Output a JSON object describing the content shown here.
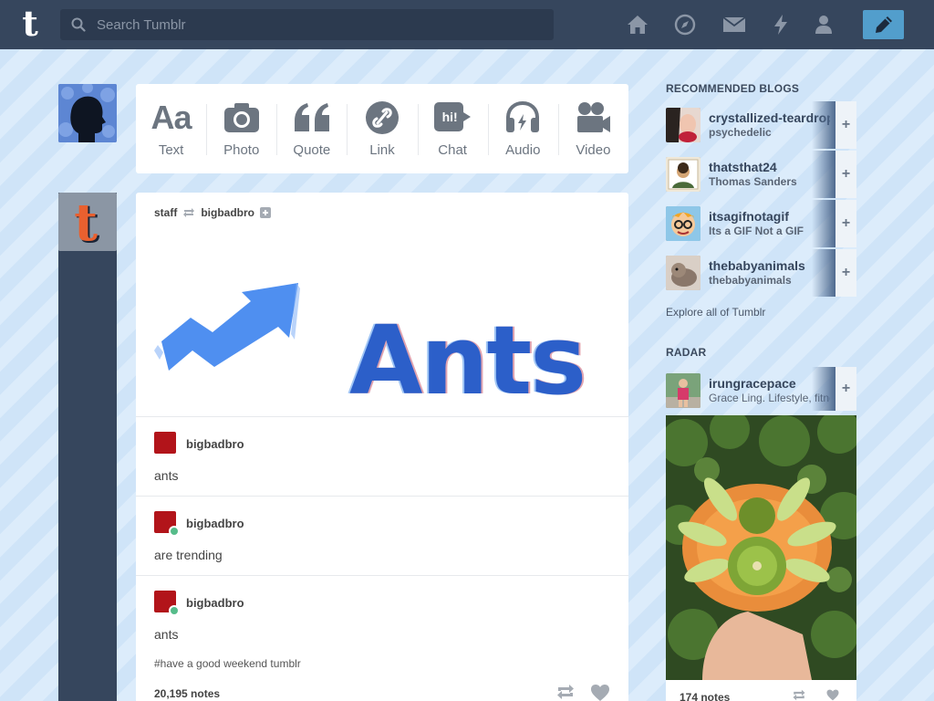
{
  "header": {
    "logo_letter": "t",
    "search_placeholder": "Search Tumblr",
    "nav_icons": [
      "home-icon",
      "compass-icon",
      "mail-icon",
      "lightning-icon",
      "person-icon"
    ],
    "compose_icon": "pencil-icon",
    "accent": "#529ecc",
    "bar_color": "#36465d"
  },
  "post_types": [
    {
      "label": "Text",
      "icon": "text-icon",
      "glyph": "Aa"
    },
    {
      "label": "Photo",
      "icon": "camera-icon"
    },
    {
      "label": "Quote",
      "icon": "quote-icon",
      "glyph": "“"
    },
    {
      "label": "Link",
      "icon": "link-icon"
    },
    {
      "label": "Chat",
      "icon": "chat-icon",
      "glyph": "hi!"
    },
    {
      "label": "Audio",
      "icon": "headphones-icon"
    },
    {
      "label": "Video",
      "icon": "video-camera-icon"
    }
  ],
  "post": {
    "author": "staff",
    "reblogged_from": "bigbadbro",
    "image_text": "Ants",
    "reblogs": [
      {
        "name": "bigbadbro",
        "text": "ants"
      },
      {
        "name": "bigbadbro",
        "text": "are trending"
      },
      {
        "name": "bigbadbro",
        "text": "ants"
      }
    ],
    "tags": "#have a good weekend tumblr",
    "notes": "20,195 notes"
  },
  "sidebar": {
    "recommended_title": "RECOMMENDED BLOGS",
    "recommended": [
      {
        "name": "crystallized-teardrops",
        "subtitle": "psychedelic"
      },
      {
        "name": "thatsthat24",
        "subtitle": "Thomas Sanders"
      },
      {
        "name": "itsagifnotagif",
        "subtitle": "Its a GIF Not a GIF"
      },
      {
        "name": "thebabyanimals",
        "subtitle": "thebabyanimals"
      }
    ],
    "explore_link": "Explore all of Tumblr",
    "radar_title": "RADAR",
    "radar": {
      "name": "irungracepace",
      "subtitle": "Grace Ling. Lifestyle, fitness",
      "notes": "174 notes"
    }
  }
}
